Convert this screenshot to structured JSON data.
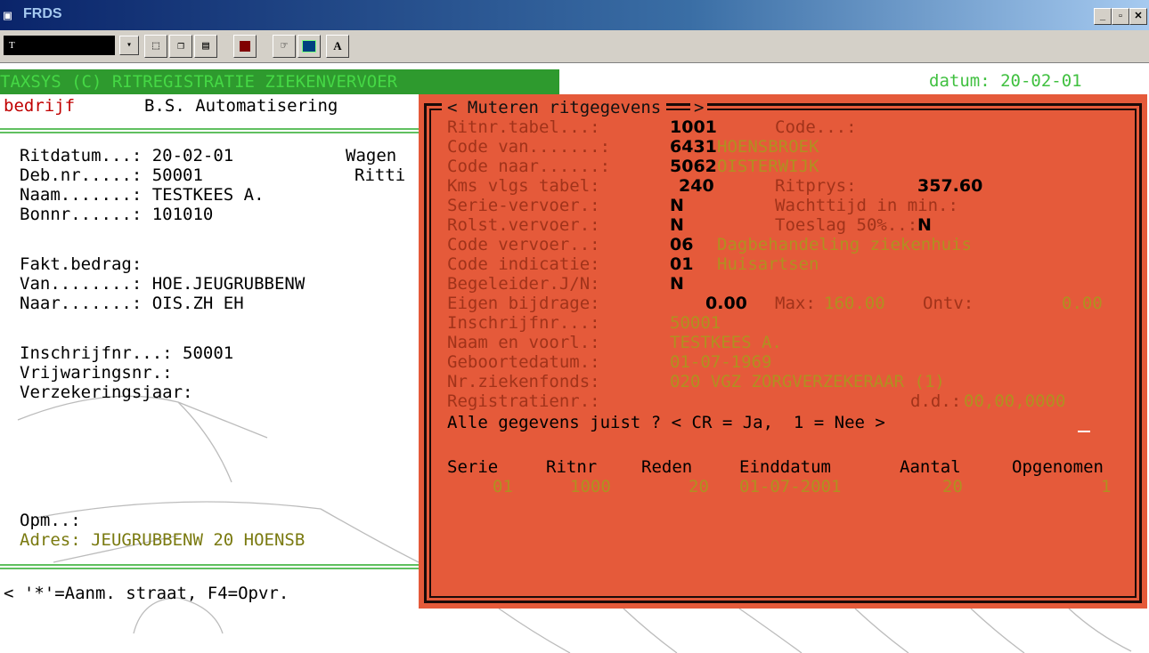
{
  "window": {
    "title": "FRDS",
    "icon": "dos-icon",
    "controls": [
      "_",
      "□",
      "×"
    ]
  },
  "toolbar": {
    "font_box": "T",
    "buttons": [
      "select-icon",
      "copy-icon",
      "paste-icon",
      "fullscreen-icon",
      "properties-icon",
      "background-icon",
      "font-icon"
    ],
    "font_button_label": "A"
  },
  "header": {
    "banner": "TAXSYS (C) RITREGISTRATIE ZIEKENVERVOER",
    "datum": "datum: 20-02-01",
    "bedrijf_label": "bedrijf",
    "bedrijf_value": "B.S. Automatisering"
  },
  "left": {
    "ritdatum": "Ritdatum...: 20-02-01",
    "wagen": "Wagen",
    "debnr": "Deb.nr.....: 50001",
    "ritti": "Ritti",
    "naam": "Naam.......: TESTKEES A.",
    "bonnr": "Bonnr......: 101010",
    "fakt": "Fakt.bedrag:",
    "van": "Van........: HOE.JEUGRUBBENW",
    "naar": "Naar.......: OIS.ZH EH",
    "inschrijf": "Inschrijfnr...: 50001",
    "vrijwaring": "Vrijwaringsnr.:",
    "verzekering": "Verzekeringsjaar:",
    "opm": "Opm..:",
    "adres": "Adres: JEUGRUBBENW 20 HOENSB",
    "status": "< '*'=Aanm. straat, F4=Opvr."
  },
  "popup": {
    "title": "< Muteren ritgegevens",
    "title_end": ">",
    "rows": {
      "ritnr_label": "Ritnr.tabel...:",
      "ritnr": "1001",
      "code_label": "Code...:",
      "van_label": "Code van.......:",
      "van_code": "6431",
      "van_name": "HOENSBROEK",
      "naar_label": "Code naar......:",
      "naar_code": "5062",
      "naar_name": "OISTERWIJK",
      "kms_label": "Kms vlgs tabel:",
      "kms": "240",
      "ritprys_label": "Ritprys:",
      "ritprys": "357.60",
      "serie_label": "Serie-vervoer.:",
      "serie": "N",
      "wacht_label": "Wachttijd in min.:",
      "rolst_label": "Rolst.vervoer.:",
      "rolst": "N",
      "toeslag_label": "Toeslag 50%..:",
      "toeslag": "N",
      "vervoer_label": "Code vervoer..:",
      "vervoer_code": "06",
      "vervoer_name": "Dagbehandeling ziekenhuis",
      "indicatie_label": "Code indicatie:",
      "indicatie_code": "01",
      "indicatie_name": "Huisartsen",
      "begeleider_label": "Begeleider.J/N:",
      "begeleider": "N",
      "eigen_label": "Eigen bijdrage:",
      "eigen": "0.00",
      "max_label": "Max:",
      "max": "160.00",
      "ontv_label": "Ontv:",
      "ontv": "0.00",
      "inschrijf_label": "Inschrijfnr...:",
      "inschrijf": "50001",
      "naamvoorl_label": "Naam en voorl.:",
      "naamvoorl": "TESTKEES A.",
      "geboorte_label": "Geboortedatum.:",
      "geboorte": "01-07-1969",
      "ziekenfonds_label": "Nr.ziekenfonds:",
      "ziekenfonds": "020 VGZ ZORGVERZEKERAAR (1)",
      "registratie_label": "Registratienr.:",
      "dd_label": "d.d.:",
      "dd": "00,00,0000"
    },
    "confirm": "Alle gegevens juist ? < CR = Ja,  1 = Nee >",
    "table": {
      "headers": [
        "Serie",
        "Ritnr",
        "Reden",
        "Einddatum",
        "Aantal",
        "Opgenomen"
      ],
      "row": [
        "01",
        "1000",
        "20",
        "01-07-2001",
        "20",
        "1"
      ]
    }
  },
  "colors": {
    "popup_bg": "#e55a3a",
    "banner_bg": "#2e9a2e",
    "banner_fg": "#45d845",
    "accent_green": "#b09020"
  }
}
